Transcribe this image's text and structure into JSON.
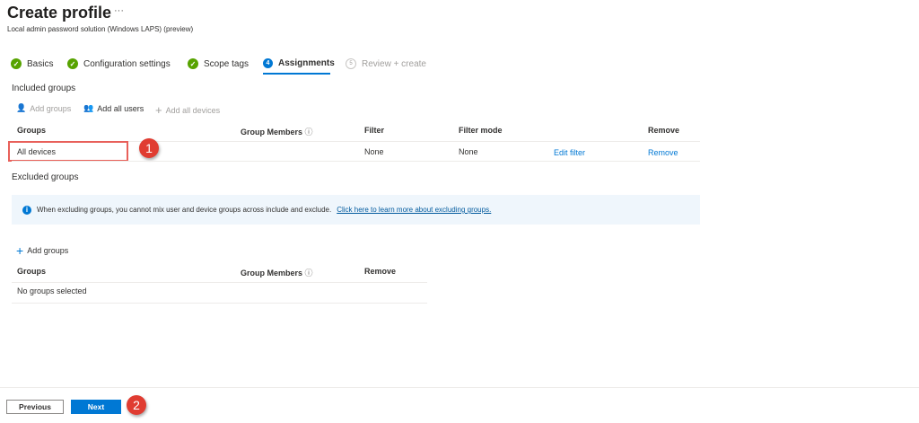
{
  "header": {
    "title": "Create profile",
    "more": "···",
    "subtitle": "Local admin password solution (Windows LAPS) (preview)"
  },
  "tabs": [
    {
      "label": "Basics",
      "state": "done"
    },
    {
      "label": "Configuration settings",
      "state": "done"
    },
    {
      "label": "Scope tags",
      "state": "done"
    },
    {
      "label": "Assignments",
      "state": "active",
      "number": "4"
    },
    {
      "label": "Review + create",
      "state": "disabled",
      "number": "5"
    }
  ],
  "included": {
    "title": "Included groups",
    "actions": {
      "add_groups": "Add groups",
      "add_all_users": "Add all users",
      "add_all_devices": "Add all devices"
    },
    "columns": [
      "Groups",
      "Group Members",
      "Filter",
      "Filter mode",
      "Remove"
    ],
    "rows": [
      {
        "group": "All devices",
        "filter": "None",
        "filter_mode": "None",
        "edit": "Edit filter",
        "remove": "Remove"
      }
    ]
  },
  "excluded": {
    "title": "Excluded groups",
    "info": "When excluding groups, you cannot mix user and device groups across include and exclude.",
    "info_link": "Click here to learn more about excluding groups.",
    "add_groups": "Add groups",
    "columns": [
      "Groups",
      "Group Members",
      "Remove"
    ],
    "empty": "No groups selected"
  },
  "annotations": [
    "1",
    "2"
  ],
  "footer": {
    "previous": "Previous",
    "next": "Next"
  },
  "colors": {
    "accent": "#0078d4",
    "success": "#57a300",
    "annotation": "#e03c31"
  }
}
